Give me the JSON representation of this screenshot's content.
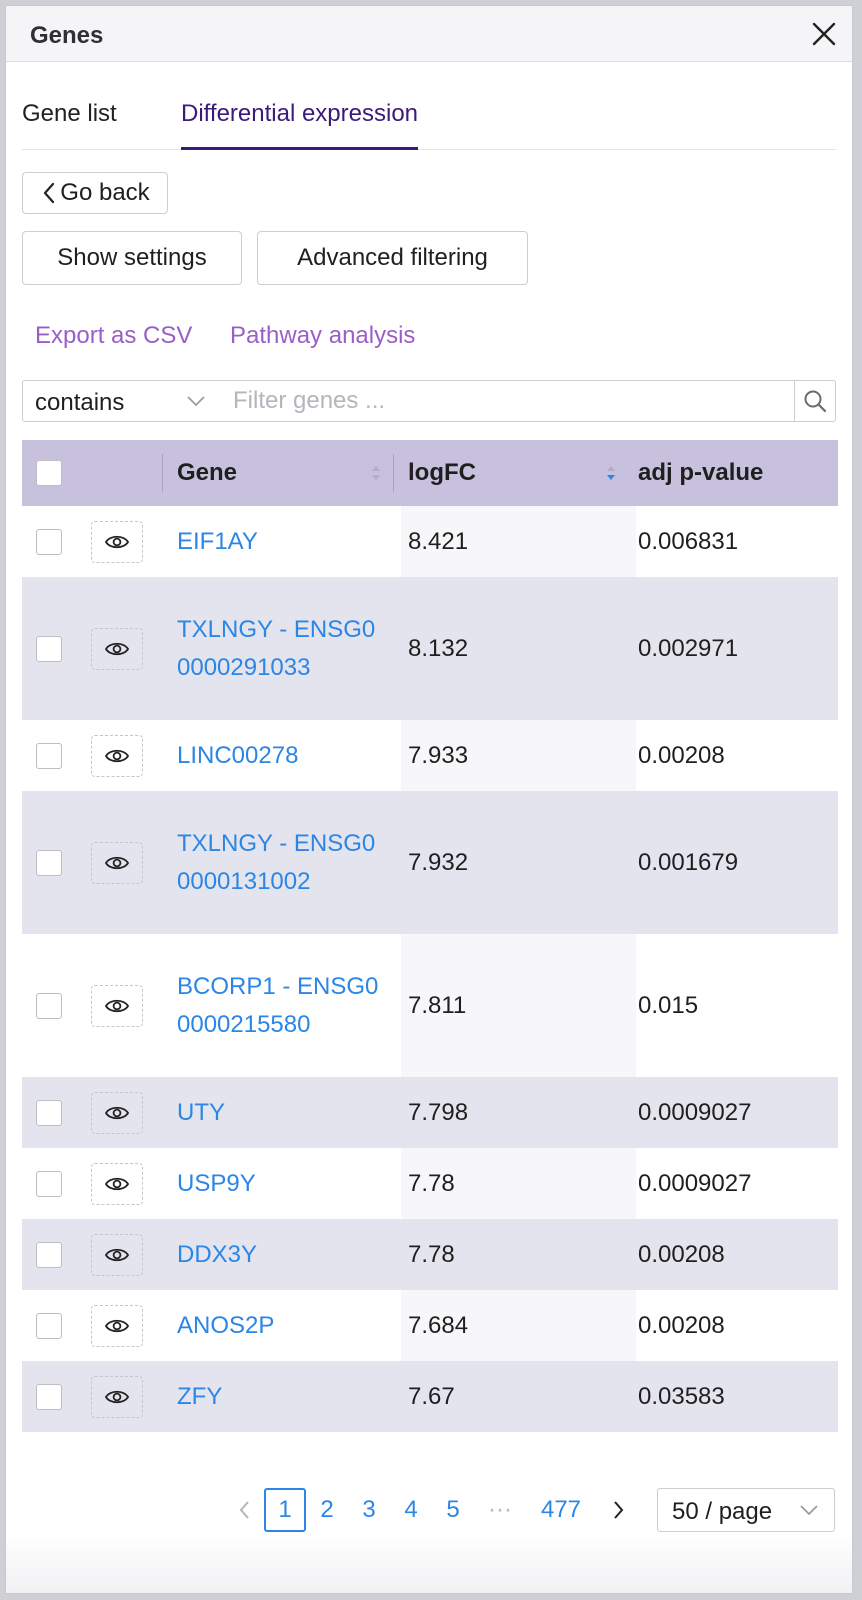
{
  "panel": {
    "title": "Genes"
  },
  "tabs": [
    {
      "label": "Gene list",
      "active": false
    },
    {
      "label": "Differential expression",
      "active": true
    }
  ],
  "buttons": {
    "go_back": "Go back",
    "show_settings": "Show settings",
    "advanced_filtering": "Advanced filtering"
  },
  "links": {
    "export_csv": "Export as CSV",
    "pathway_analysis": "Pathway analysis"
  },
  "filter": {
    "mode": "contains",
    "placeholder": "Filter genes ..."
  },
  "table": {
    "columns": [
      "Gene",
      "logFC",
      "adj p-value"
    ],
    "sorted_column": "logFC",
    "sort_direction": "descending",
    "rows": [
      {
        "gene": "EIF1AY",
        "logFC": "8.421",
        "padj": "0.006831"
      },
      {
        "gene": "TXLNGY - ENSG00000291033",
        "logFC": "8.132",
        "padj": "0.002971"
      },
      {
        "gene": "LINC00278",
        "logFC": "7.933",
        "padj": "0.00208"
      },
      {
        "gene": "TXLNGY - ENSG00000131002",
        "logFC": "7.932",
        "padj": "0.001679"
      },
      {
        "gene": "BCORP1 - ENSG00000215580",
        "logFC": "7.811",
        "padj": "0.015"
      },
      {
        "gene": "UTY",
        "logFC": "7.798",
        "padj": "0.0009027"
      },
      {
        "gene": "USP9Y",
        "logFC": "7.78",
        "padj": "0.0009027"
      },
      {
        "gene": "DDX3Y",
        "logFC": "7.78",
        "padj": "0.00208"
      },
      {
        "gene": "ANOS2P",
        "logFC": "7.684",
        "padj": "0.00208"
      },
      {
        "gene": "ZFY",
        "logFC": "7.67",
        "padj": "0.03583"
      }
    ]
  },
  "pagination": {
    "pages": [
      "1",
      "2",
      "3",
      "4",
      "5"
    ],
    "current": "1",
    "ellipsis": "···",
    "last": "477",
    "page_size": "50 / page"
  },
  "colors": {
    "accent": "#3b1a7a",
    "link": "#2b86e5",
    "secondary_link": "#9a5fc7",
    "header_bg": "#c7c1dd",
    "row_alt": "#e4e4ee"
  }
}
